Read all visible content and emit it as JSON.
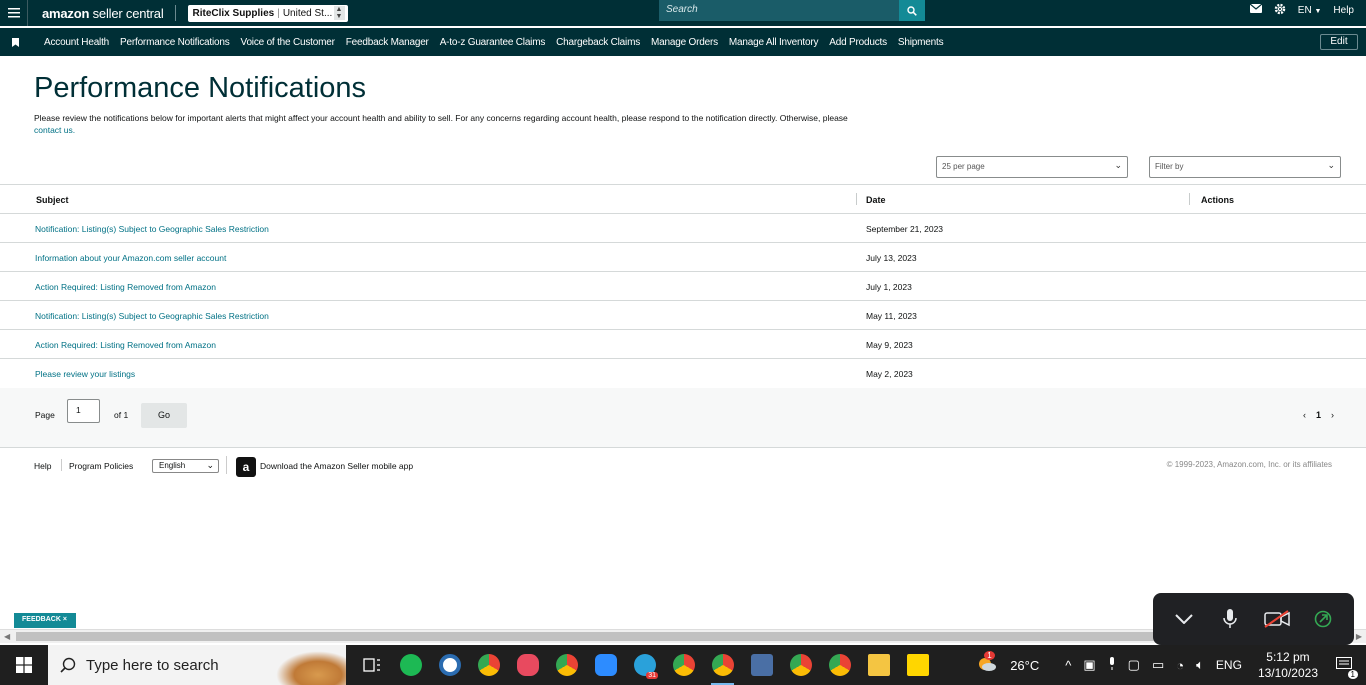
{
  "topbar": {
    "logo_bold": "amazon",
    "logo_rest": " seller central",
    "store_name": "RiteClix Supplies",
    "store_region": "United St...",
    "search_placeholder": "Search",
    "language": "EN",
    "help": "Help"
  },
  "nav": {
    "items": [
      "Account Health",
      "Performance Notifications",
      "Voice of the Customer",
      "Feedback Manager",
      "A-to-z Guarantee Claims",
      "Chargeback Claims",
      "Manage Orders",
      "Manage All Inventory",
      "Add Products",
      "Shipments"
    ],
    "edit": "Edit"
  },
  "page": {
    "title": "Performance Notifications",
    "description": "Please review the notifications below for important alerts that might affect your account health and ability to sell. For any concerns regarding account health, please respond to the notification directly. Otherwise, please",
    "contact_link": "contact us.",
    "per_page": "25 per page",
    "filter": "Filter by"
  },
  "table": {
    "columns": [
      "Subject",
      "Date",
      "Actions"
    ],
    "rows": [
      {
        "subject": "Notification: Listing(s) Subject to Geographic Sales Restriction",
        "date": "September 21, 2023"
      },
      {
        "subject": "Information about your Amazon.com seller account",
        "date": "July 13, 2023"
      },
      {
        "subject": "Action Required: Listing Removed from Amazon",
        "date": "July 1, 2023"
      },
      {
        "subject": "Notification: Listing(s) Subject to Geographic Sales Restriction",
        "date": "May 11, 2023"
      },
      {
        "subject": "Action Required: Listing Removed from Amazon",
        "date": "May 9, 2023"
      },
      {
        "subject": "Please review your listings",
        "date": "May 2, 2023"
      }
    ]
  },
  "pager": {
    "page_label": "Page",
    "page_value": "1",
    "of_label": "of 1",
    "go": "Go",
    "prev": "‹",
    "current": "1",
    "next": "›"
  },
  "footer": {
    "help": "Help",
    "program_policies": "Program Policies",
    "language": "English",
    "app_icon": "a",
    "app_text": "Download the Amazon Seller mobile app",
    "copyright": "© 1999-2023, Amazon.com, Inc. or its affiliates"
  },
  "feedback": "FEEDBACK ×",
  "taskbar": {
    "search_placeholder": "Type here to search",
    "weather": "26°C",
    "lang": "ENG",
    "time": "5:12 pm",
    "date": "13/10/2023",
    "notification_count": "1",
    "calendar_badge": "31",
    "weather_badge": "1"
  },
  "colors": {
    "header_bg": "#002f36",
    "link": "#007185",
    "accent": "#138a96"
  }
}
